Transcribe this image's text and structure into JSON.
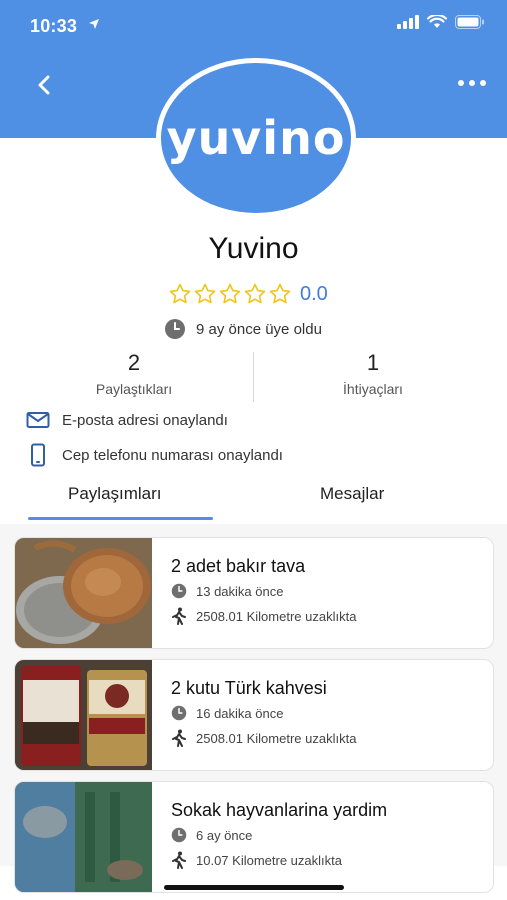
{
  "status_bar": {
    "time": "10:33"
  },
  "profile": {
    "logo_text": "yuvino",
    "name": "Yuvino",
    "rating_value": "0.0",
    "stars": 5,
    "member_since": "9 ay önce üye oldu"
  },
  "stats": [
    {
      "value": "2",
      "label": "Paylaştıkları"
    },
    {
      "value": "1",
      "label": "İhtiyaçları"
    }
  ],
  "verifications": {
    "email": "E-posta adresi onaylandı",
    "phone": "Cep telefonu numarası onaylandı"
  },
  "tabs": {
    "shares": "Paylaşımları",
    "messages": "Mesajlar",
    "active": "shares"
  },
  "listings": [
    {
      "title": "2 adet bakır tava",
      "time": "13 dakika önce",
      "distance": "2508.01 Kilometre uzaklıkta"
    },
    {
      "title": "2 kutu Türk kahvesi",
      "time": "16 dakika önce",
      "distance": "2508.01 Kilometre uzaklıkta"
    },
    {
      "title": "Sokak hayvanlarina yardim",
      "time": "6 ay önce",
      "distance": "10.07 Kilometre uzaklıkta"
    }
  ],
  "colors": {
    "accent": "#4f8fe4",
    "star": "#f0c419",
    "rating_text": "#3d7ee0"
  }
}
